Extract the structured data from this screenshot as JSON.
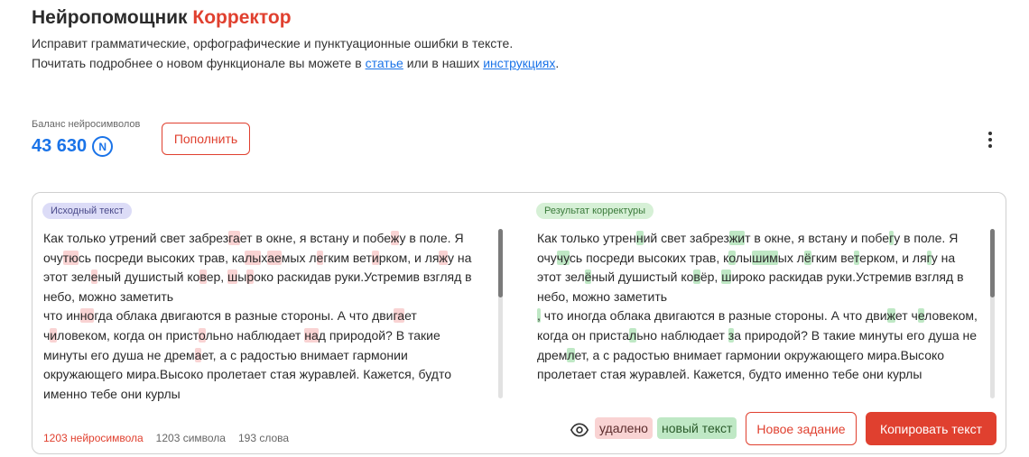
{
  "header": {
    "title_main": "Нейропомощник",
    "title_accent": "Корректор",
    "desc_line1": "Исправит грамматические, орфографические и пунктуационные ошибки в тексте.",
    "desc_line2_pre": "Почитать подробнее о новом функционале вы можете в ",
    "link_article": "статье",
    "desc_line2_mid": " или в наших ",
    "link_instructions": "инструкциях",
    "desc_line2_post": "."
  },
  "balance": {
    "label": "Баланс нейросимволов",
    "value": "43 630",
    "currency_symbol": "N",
    "topup_label": "Пополнить"
  },
  "panel": {
    "source_tag": "Исходный текст",
    "result_tag": "Результат корректуры",
    "source_segments": [
      [
        "t",
        "Как только утрений свет забрез"
      ],
      [
        "d",
        "га"
      ],
      [
        "t",
        "ет в окне, я встану и побе"
      ],
      [
        "d",
        "ж"
      ],
      [
        "t",
        "у в поле. Я очу"
      ],
      [
        "d",
        "тю"
      ],
      [
        "t",
        "сь посреди высоких трав, ка"
      ],
      [
        "d",
        "лы"
      ],
      [
        "t",
        "х"
      ],
      [
        "d",
        "ае"
      ],
      [
        "t",
        "мых л"
      ],
      [
        "d",
        "е"
      ],
      [
        "t",
        "гким вет"
      ],
      [
        "d",
        "и"
      ],
      [
        "t",
        "рком, и ля"
      ],
      [
        "d",
        "ж"
      ],
      [
        "t",
        "у на этот зел"
      ],
      [
        "d",
        "е"
      ],
      [
        "t",
        "ный душистый ко"
      ],
      [
        "d",
        "в"
      ],
      [
        "t",
        "ер, "
      ],
      [
        "d",
        "ш"
      ],
      [
        "t",
        "ы"
      ],
      [
        "d",
        "р"
      ],
      [
        "t",
        "око раскидав руки.Устремив взгляд в небо, можно заметить "
      ],
      [
        "br",
        ""
      ],
      [
        "t",
        "что ин"
      ],
      [
        "d",
        "но"
      ],
      [
        "t",
        "гда облака двигаются в разные стороны. А что дви"
      ],
      [
        "d",
        "га"
      ],
      [
        "t",
        "ет ч"
      ],
      [
        "d",
        "и"
      ],
      [
        "t",
        "ловеком, когда он прист"
      ],
      [
        "d",
        "о"
      ],
      [
        "t",
        "льно наблюдает "
      ],
      [
        "d",
        "на"
      ],
      [
        "t",
        "д природой? В такие минуты его душа не дрем"
      ],
      [
        "d",
        "а"
      ],
      [
        "t",
        "ет, а с радостью внимает гармонии окружающего мира.Высоко пролетает стая журавлей. Кажется, будто именно тебе они курлы"
      ]
    ],
    "result_segments": [
      [
        "t",
        "Как только утрен"
      ],
      [
        "i",
        "н"
      ],
      [
        "t",
        "ий свет забрез"
      ],
      [
        "i",
        "жи"
      ],
      [
        "t",
        "т в окне, я встану и побе"
      ],
      [
        "i",
        "г"
      ],
      [
        "t",
        "у в поле. Я очу"
      ],
      [
        "i",
        "чу"
      ],
      [
        "t",
        "сь посреди высоких трав, к"
      ],
      [
        "i",
        "о"
      ],
      [
        "t",
        "лы"
      ],
      [
        "i",
        "шим"
      ],
      [
        "t",
        "ых л"
      ],
      [
        "i",
        "ё"
      ],
      [
        "t",
        "гким ве"
      ],
      [
        "i",
        "т"
      ],
      [
        "t",
        "ерком, и ля"
      ],
      [
        "i",
        "г"
      ],
      [
        "t",
        "у на этот зел"
      ],
      [
        "i",
        "ё"
      ],
      [
        "t",
        "ный душистый ко"
      ],
      [
        "i",
        "в"
      ],
      [
        "t",
        "ёр, "
      ],
      [
        "i",
        "ш"
      ],
      [
        "t",
        "ироко раскидав руки.Устремив взгляд в небо, можно заметить "
      ],
      [
        "br",
        ""
      ],
      [
        "i",
        ","
      ],
      [
        "t",
        " что иногда облака двигаются в разные стороны. А что дви"
      ],
      [
        "i",
        "ж"
      ],
      [
        "t",
        "ет ч"
      ],
      [
        "i",
        "е"
      ],
      [
        "t",
        "ловеком, когда он приста"
      ],
      [
        "i",
        "л"
      ],
      [
        "t",
        "ьно наблюдает "
      ],
      [
        "i",
        "з"
      ],
      [
        "t",
        "а природой? В такие минуты его душа не дрем"
      ],
      [
        "i",
        "л"
      ],
      [
        "t",
        "ет, а с радостью внимает гармонии окружающего мира.Высоко пролетает стая журавлей. Кажется, будто именно тебе они курлы"
      ]
    ],
    "stats": {
      "neuro": "1203 нейросимвола",
      "symbols": "1203 символа",
      "words": "193 слова"
    },
    "legend_removed": "удалено",
    "legend_new": "новый текст",
    "new_task_label": "Новое задание",
    "copy_label": "Копировать текст"
  },
  "colors": {
    "accent": "#e0402f",
    "link": "#1a73e8",
    "deleted_bg": "#f9d3d3",
    "inserted_bg": "#bfe8c5"
  }
}
